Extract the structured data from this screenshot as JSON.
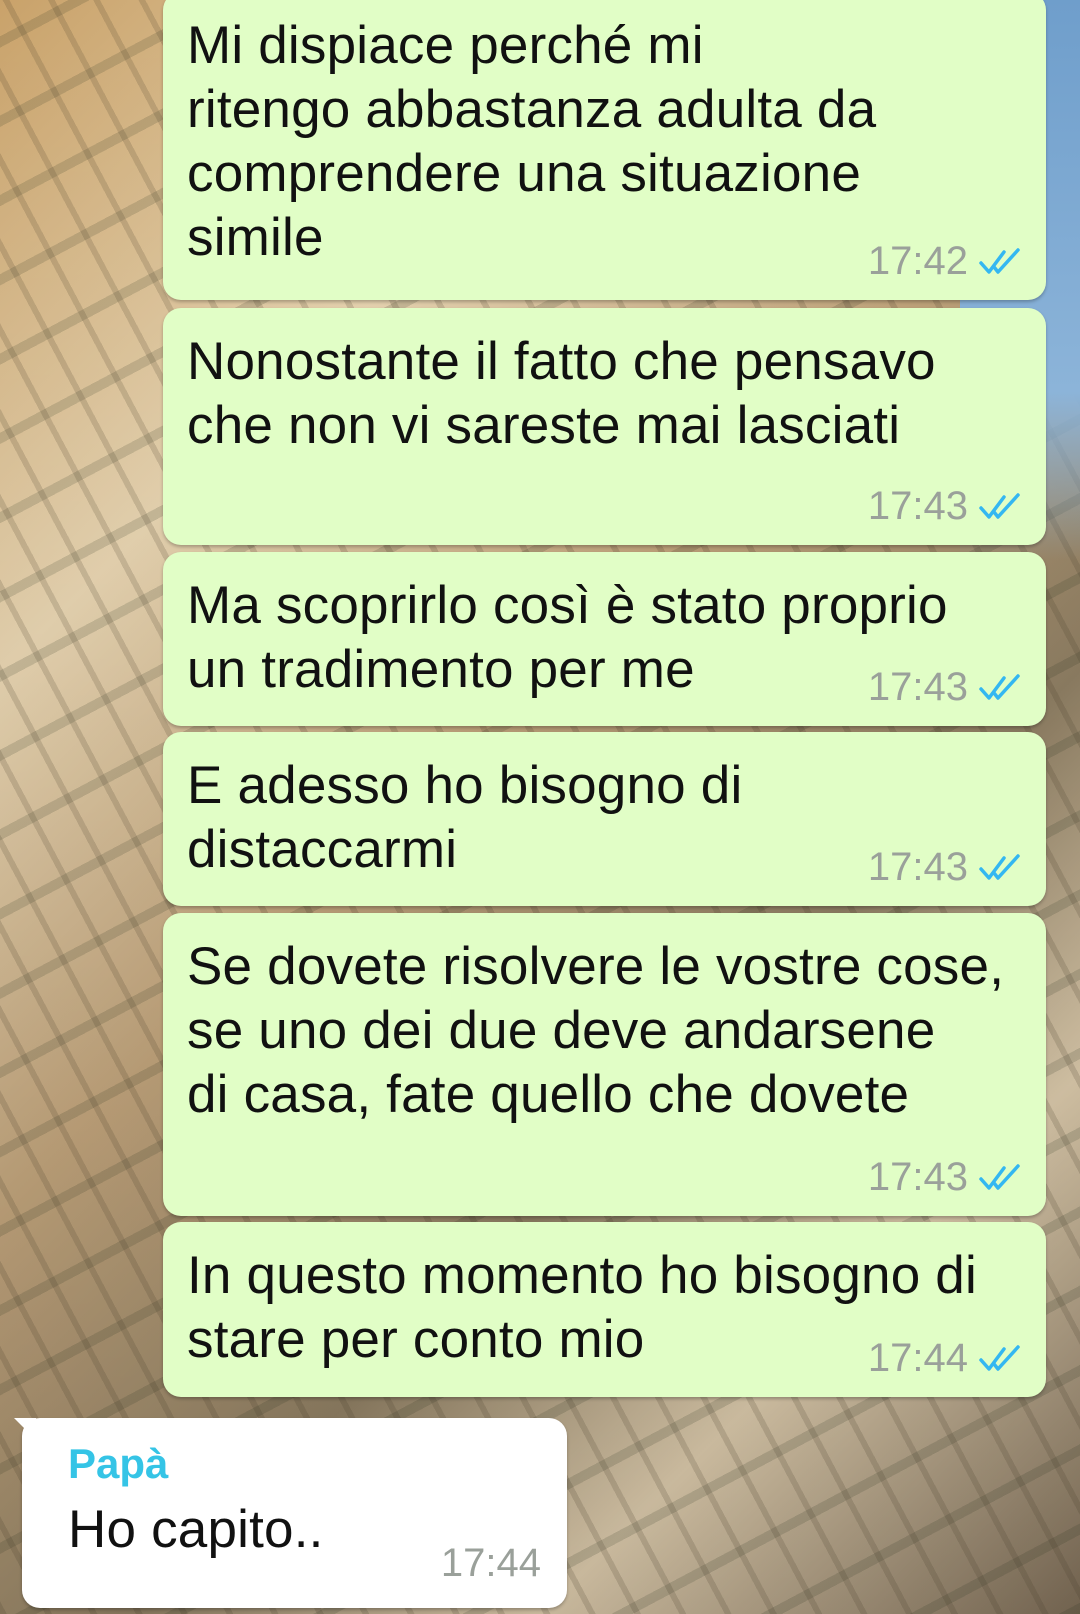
{
  "messages": [
    {
      "direction": "out",
      "text": "Mi dispiace perché mi\nritengo abbastanza adulta da\ncomprendere una situazione\nsimile",
      "time": "17:42",
      "status": "read"
    },
    {
      "direction": "out",
      "text": "Nonostante il fatto che pensavo\nche non vi sareste mai lasciati",
      "time": "17:43",
      "status": "read"
    },
    {
      "direction": "out",
      "text": "Ma scoprirlo così è stato proprio\nun tradimento per me",
      "time": "17:43",
      "status": "read"
    },
    {
      "direction": "out",
      "text": "E adesso ho bisogno di\ndistaccarmi",
      "time": "17:43",
      "status": "read"
    },
    {
      "direction": "out",
      "text": "Se dovete risolvere le vostre cose,\nse uno dei due deve andarsene\ndi casa, fate quello che dovete",
      "time": "17:43",
      "status": "read"
    },
    {
      "direction": "out",
      "text": "In questo momento ho bisogno di\nstare per conto mio",
      "time": "17:44",
      "status": "read"
    },
    {
      "direction": "in",
      "sender": "Papà",
      "text": "Ho capito..",
      "time": "17:44"
    }
  ],
  "colors": {
    "outgoing_bubble": "#e1fec6",
    "incoming_bubble": "#ffffff",
    "read_ticks": "#34b7f1",
    "sender_name": "#35c4e6",
    "timestamp": "#9aa09a"
  },
  "icons": {
    "read_receipt": "double-check-icon"
  }
}
